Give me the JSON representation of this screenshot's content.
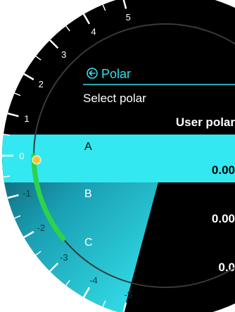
{
  "screen": {
    "title": "Polar",
    "subtitle": "Select polar",
    "current_value": "User polar"
  },
  "list": [
    {
      "letter": "A",
      "value": "0.00",
      "selected": true
    },
    {
      "letter": "B",
      "value": "0.00",
      "selected": false
    },
    {
      "letter": "C",
      "value": "0.0",
      "selected": false
    }
  ],
  "gauge": {
    "ticks": [
      "5",
      "4",
      "3",
      "2",
      "1",
      "0",
      "-1",
      "-2",
      "-3",
      "-4",
      "-5"
    ],
    "indicator_value": -2.6
  },
  "colors": {
    "background": "#000000",
    "accent_cyan": "#33e8f0",
    "positive_fill": "#2dd34a",
    "indicator_dot": "#f5c63a",
    "title_text": "#31e2ee",
    "text": "#ffffff"
  },
  "icons": {
    "back": "back-arrow-circle-icon"
  }
}
